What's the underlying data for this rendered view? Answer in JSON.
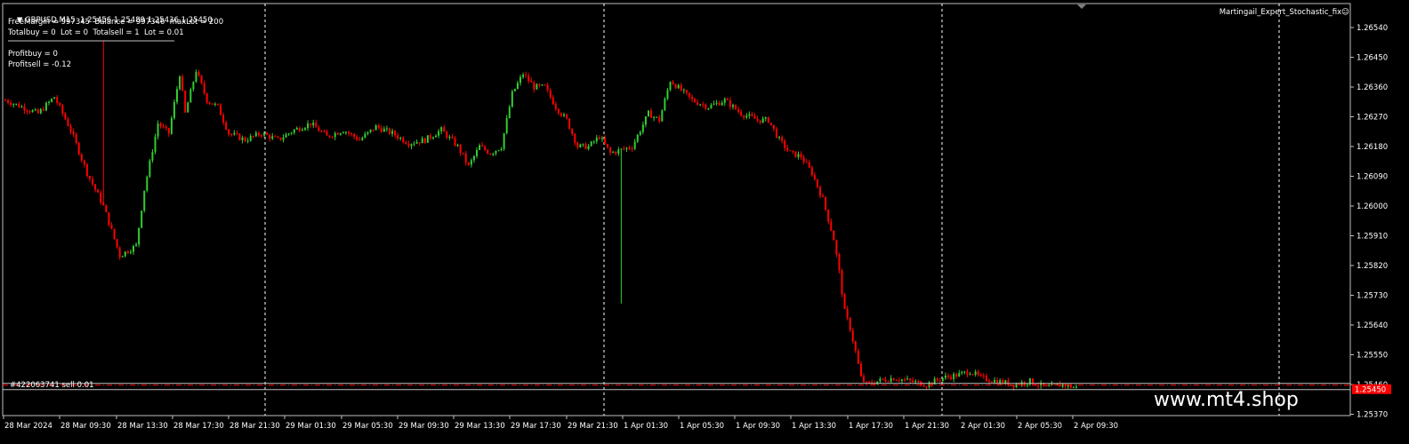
{
  "header": {
    "symbol_line": "GBPUSD,M15  1.25456 1.25489 1.25436 1.25450",
    "info_line1": "FreeMargin = 997345  Balance = 997346  maxLot = 200",
    "info_line2": "Totalbuy = 0  Lot = 0  Totalsell = 1  Lot = 0.01",
    "profit_buy": "Profitbuy = 0",
    "profit_sell": "Profitsell = -0.12"
  },
  "expert_label": "Martingail_Expert_Stochastic_fix☺",
  "order_label": "#422063741 sell 0.01",
  "watermark": "www.mt4.shop",
  "colors": {
    "background": "#000000",
    "bull": "#32cd32",
    "bear": "#ff0000",
    "grid": "#ffffff",
    "axis_text": "#ffffff",
    "order_line": "#ff0000",
    "price_tag": "#ff0000"
  },
  "chart_data": {
    "type": "candlestick",
    "symbol": "GBPUSD",
    "timeframe": "M15",
    "y_ticks": [
      "1.26540",
      "1.26450",
      "1.26360",
      "1.26270",
      "1.26180",
      "1.26090",
      "1.26000",
      "1.25910",
      "1.25820",
      "1.25730",
      "1.25640",
      "1.25550",
      "1.25460",
      "1.25370"
    ],
    "current_price_label": "1.25450",
    "ylim": [
      1.2533,
      1.2658
    ],
    "x_ticks": [
      "28 Mar 2024",
      "28 Mar 09:30",
      "28 Mar 13:30",
      "28 Mar 17:30",
      "28 Mar 21:30",
      "29 Mar 01:30",
      "29 Mar 05:30",
      "29 Mar 09:30",
      "29 Mar 13:30",
      "29 Mar 17:30",
      "29 Mar 21:30",
      "1 Apr 01:30",
      "1 Apr 05:30",
      "1 Apr 09:30",
      "1 Apr 13:30",
      "1 Apr 17:30",
      "1 Apr 21:30",
      "2 Apr 01:30",
      "2 Apr 05:30",
      "2 Apr 09:30"
    ],
    "close_path": [
      [
        0,
        1.2632
      ],
      [
        6,
        1.263
      ],
      [
        12,
        1.2628
      ],
      [
        18,
        1.2633
      ],
      [
        24,
        1.2623
      ],
      [
        30,
        1.261
      ],
      [
        36,
        1.26
      ],
      [
        42,
        1.2585
      ],
      [
        48,
        1.2588
      ],
      [
        51,
        1.2605
      ],
      [
        56,
        1.2625
      ],
      [
        60,
        1.2622
      ],
      [
        64,
        1.264
      ],
      [
        66,
        1.2628
      ],
      [
        70,
        1.2641
      ],
      [
        74,
        1.2632
      ],
      [
        78,
        1.263
      ],
      [
        82,
        1.2622
      ],
      [
        88,
        1.262
      ],
      [
        94,
        1.2622
      ],
      [
        100,
        1.262
      ],
      [
        106,
        1.2623
      ],
      [
        112,
        1.2625
      ],
      [
        118,
        1.2621
      ],
      [
        124,
        1.2623
      ],
      [
        130,
        1.262
      ],
      [
        136,
        1.2624
      ],
      [
        142,
        1.2622
      ],
      [
        148,
        1.2619
      ],
      [
        154,
        1.262
      ],
      [
        160,
        1.2623
      ],
      [
        166,
        1.2618
      ],
      [
        170,
        1.2612
      ],
      [
        174,
        1.2618
      ],
      [
        178,
        1.2616
      ],
      [
        182,
        1.2618
      ],
      [
        186,
        1.2634
      ],
      [
        190,
        1.264
      ],
      [
        194,
        1.2636
      ],
      [
        198,
        1.2636
      ],
      [
        202,
        1.263
      ],
      [
        206,
        1.2626
      ],
      [
        210,
        1.2618
      ],
      [
        214,
        1.2618
      ],
      [
        218,
        1.2621
      ],
      [
        222,
        1.2616
      ],
      [
        226,
        1.2617
      ],
      [
        230,
        1.2618
      ],
      [
        236,
        1.2628
      ],
      [
        240,
        1.2626
      ],
      [
        244,
        1.2638
      ],
      [
        248,
        1.2635
      ],
      [
        252,
        1.2632
      ],
      [
        258,
        1.263
      ],
      [
        264,
        1.2632
      ],
      [
        270,
        1.2628
      ],
      [
        276,
        1.2626
      ],
      [
        280,
        1.2626
      ],
      [
        284,
        1.262
      ],
      [
        288,
        1.2616
      ],
      [
        292,
        1.2615
      ],
      [
        296,
        1.261
      ],
      [
        300,
        1.2602
      ],
      [
        304,
        1.259
      ],
      [
        306,
        1.258
      ],
      [
        308,
        1.2568
      ],
      [
        310,
        1.2563
      ],
      [
        312,
        1.2556
      ],
      [
        314,
        1.2548
      ],
      [
        316,
        1.2546
      ],
      [
        320,
        1.2547
      ],
      [
        326,
        1.2548
      ],
      [
        332,
        1.2547
      ],
      [
        338,
        1.2546
      ],
      [
        344,
        1.2548
      ],
      [
        350,
        1.2549
      ],
      [
        354,
        1.255
      ],
      [
        358,
        1.2548
      ],
      [
        364,
        1.2547
      ],
      [
        370,
        1.2546
      ],
      [
        376,
        1.2547
      ],
      [
        382,
        1.2545
      ],
      [
        388,
        1.2546
      ],
      [
        393,
        1.2545
      ]
    ],
    "spikes": [
      {
        "index": 226,
        "low": 1.25705,
        "color": "bear"
      },
      {
        "index": 36,
        "high": 1.265,
        "color": "bull"
      }
    ],
    "order_sell_price": 1.25458,
    "bid_price": 1.2545,
    "visible_bars": 394
  }
}
